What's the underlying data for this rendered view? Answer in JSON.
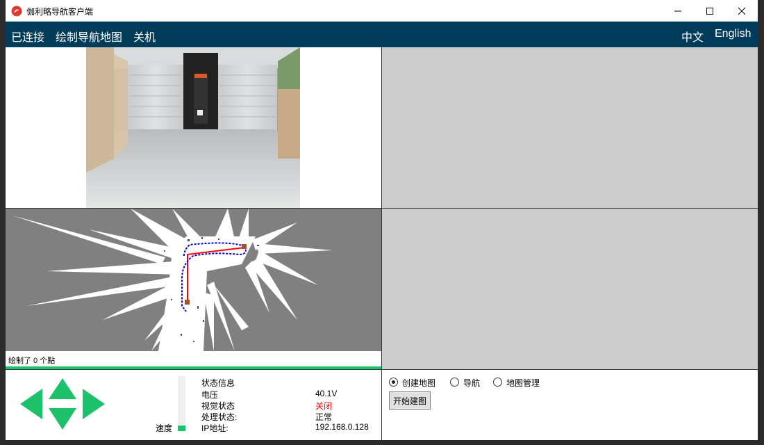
{
  "window": {
    "title": "伽利略导航客户端"
  },
  "menu": {
    "connected": "已连接",
    "draw_map": "绘制导航地图",
    "shutdown": "关机",
    "lang_zh": "中文",
    "lang_en": "English"
  },
  "map_panel": {
    "status": "绘制了 0 个點"
  },
  "speed": {
    "label": "速度",
    "level_fraction": 0.1
  },
  "status_info": {
    "title": "状态信息",
    "rows": [
      {
        "label": "电压",
        "value": "40.1V"
      },
      {
        "label": "视觉状态",
        "value": "关闭"
      },
      {
        "label": "处理状态:",
        "value": "正常"
      },
      {
        "label": "IP地址:",
        "value": "192.168.0.128"
      }
    ]
  },
  "mode": {
    "options": [
      {
        "label": "创建地图",
        "selected": true
      },
      {
        "label": "导航",
        "selected": false
      },
      {
        "label": "地图管理",
        "selected": false
      }
    ],
    "start_button": "开始建图"
  },
  "colors": {
    "menubar": "#003b59",
    "accent": "#1dc16a",
    "alert": "#ff0000",
    "panel_grey": "#cccccc",
    "map_grey": "#808080"
  },
  "icons": {
    "app": "galileo-logo-icon",
    "arrows": [
      "arrow-up-icon",
      "arrow-down-icon",
      "arrow-left-icon",
      "arrow-right-icon"
    ]
  }
}
